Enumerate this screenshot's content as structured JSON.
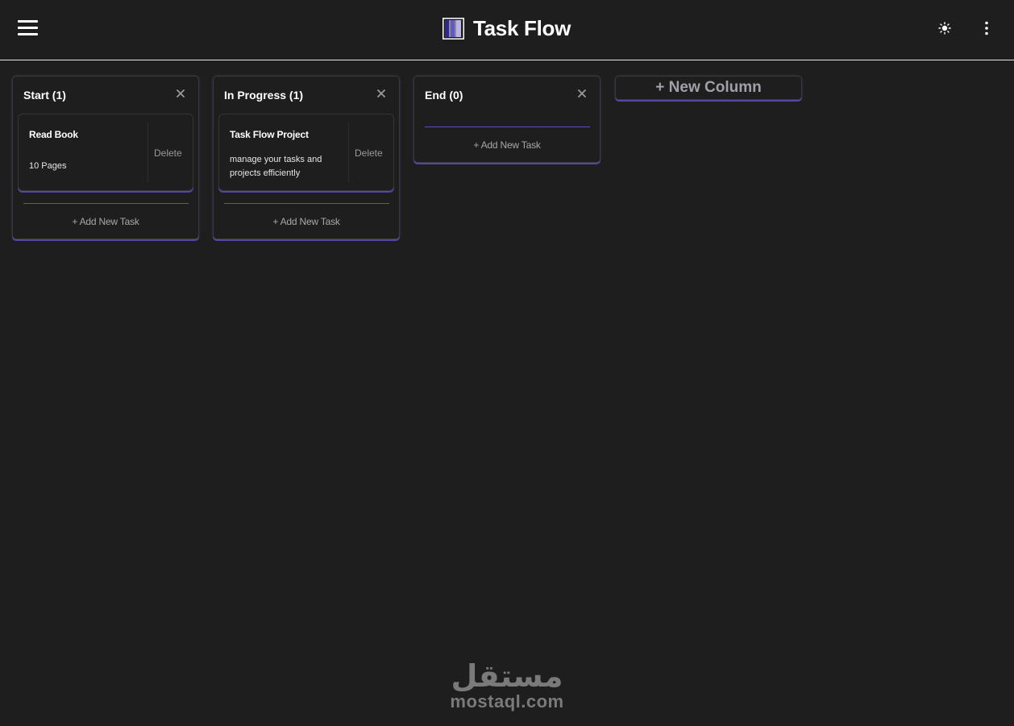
{
  "header": {
    "title": "Task Flow"
  },
  "columns": [
    {
      "title": "Start (1)",
      "tasks": [
        {
          "title": "Read Book",
          "description": "10 Pages",
          "delete_label": "Delete"
        }
      ],
      "add_task_label": "+ Add New Task"
    },
    {
      "title": "In Progress (1)",
      "tasks": [
        {
          "title": "Task Flow Project",
          "description": "manage your tasks and projects efficiently",
          "delete_label": "Delete"
        }
      ],
      "add_task_label": "+ Add New Task"
    },
    {
      "title": "End (0)",
      "tasks": [],
      "add_task_label": "+ Add New Task"
    }
  ],
  "new_column_label": "+ New Column",
  "watermark": {
    "logo_text": "مستقل",
    "text": "mostaql.com"
  },
  "colors": {
    "background": "#1e1e1e",
    "accent": "#5c4cd0",
    "text": "#ffffff",
    "muted": "#9a9a9a"
  },
  "icons": [
    "menu-icon",
    "task-flow-logo-icon",
    "sun-icon",
    "more-vertical-icon",
    "close-icon"
  ]
}
